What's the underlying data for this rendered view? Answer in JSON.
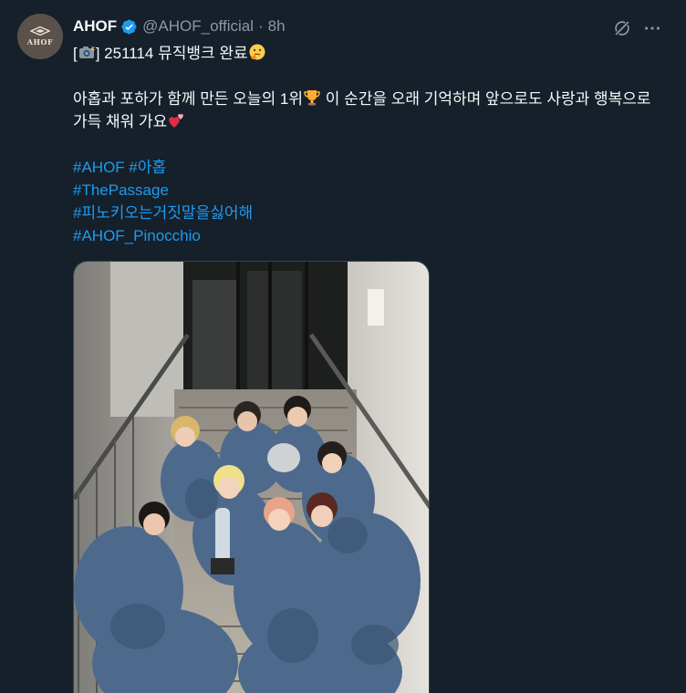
{
  "author": {
    "display_name": "AHOF",
    "handle": "@AHOF_official",
    "separator": "·",
    "time": "8h",
    "avatar_text": "AHOF",
    "verified": true,
    "verified_color": "#1d9bf0"
  },
  "tweet": {
    "line1_open": "[",
    "line1_icon": "camera-flash-emoji",
    "line1_text": "] 251114 뮤직뱅크 완료",
    "line1_icon2": "thinking-face-emoji",
    "para_part1": "아홉과 포하가 함께 만든 오늘의 1위",
    "para_icon1": "trophy-emoji",
    "para_part2": " 이 순간을 오래 기억하며 앞으로도 사랑과 행복으로 가득 채워 가요",
    "para_icon2": "two-hearts-emoji",
    "hashtags_line1": [
      "#AHOF",
      "#아홉"
    ],
    "hashtags": [
      "#ThePassage",
      "#피노키오는거짓말을싫어해",
      "#AHOF_Pinocchio"
    ]
  },
  "media": {
    "type": "photo",
    "subject": "group-photo-on-stairs-with-trophy"
  },
  "colors": {
    "background": "#15202b",
    "text": "#f7f9f9",
    "muted": "#8b98a5",
    "link": "#1d9bf0"
  }
}
